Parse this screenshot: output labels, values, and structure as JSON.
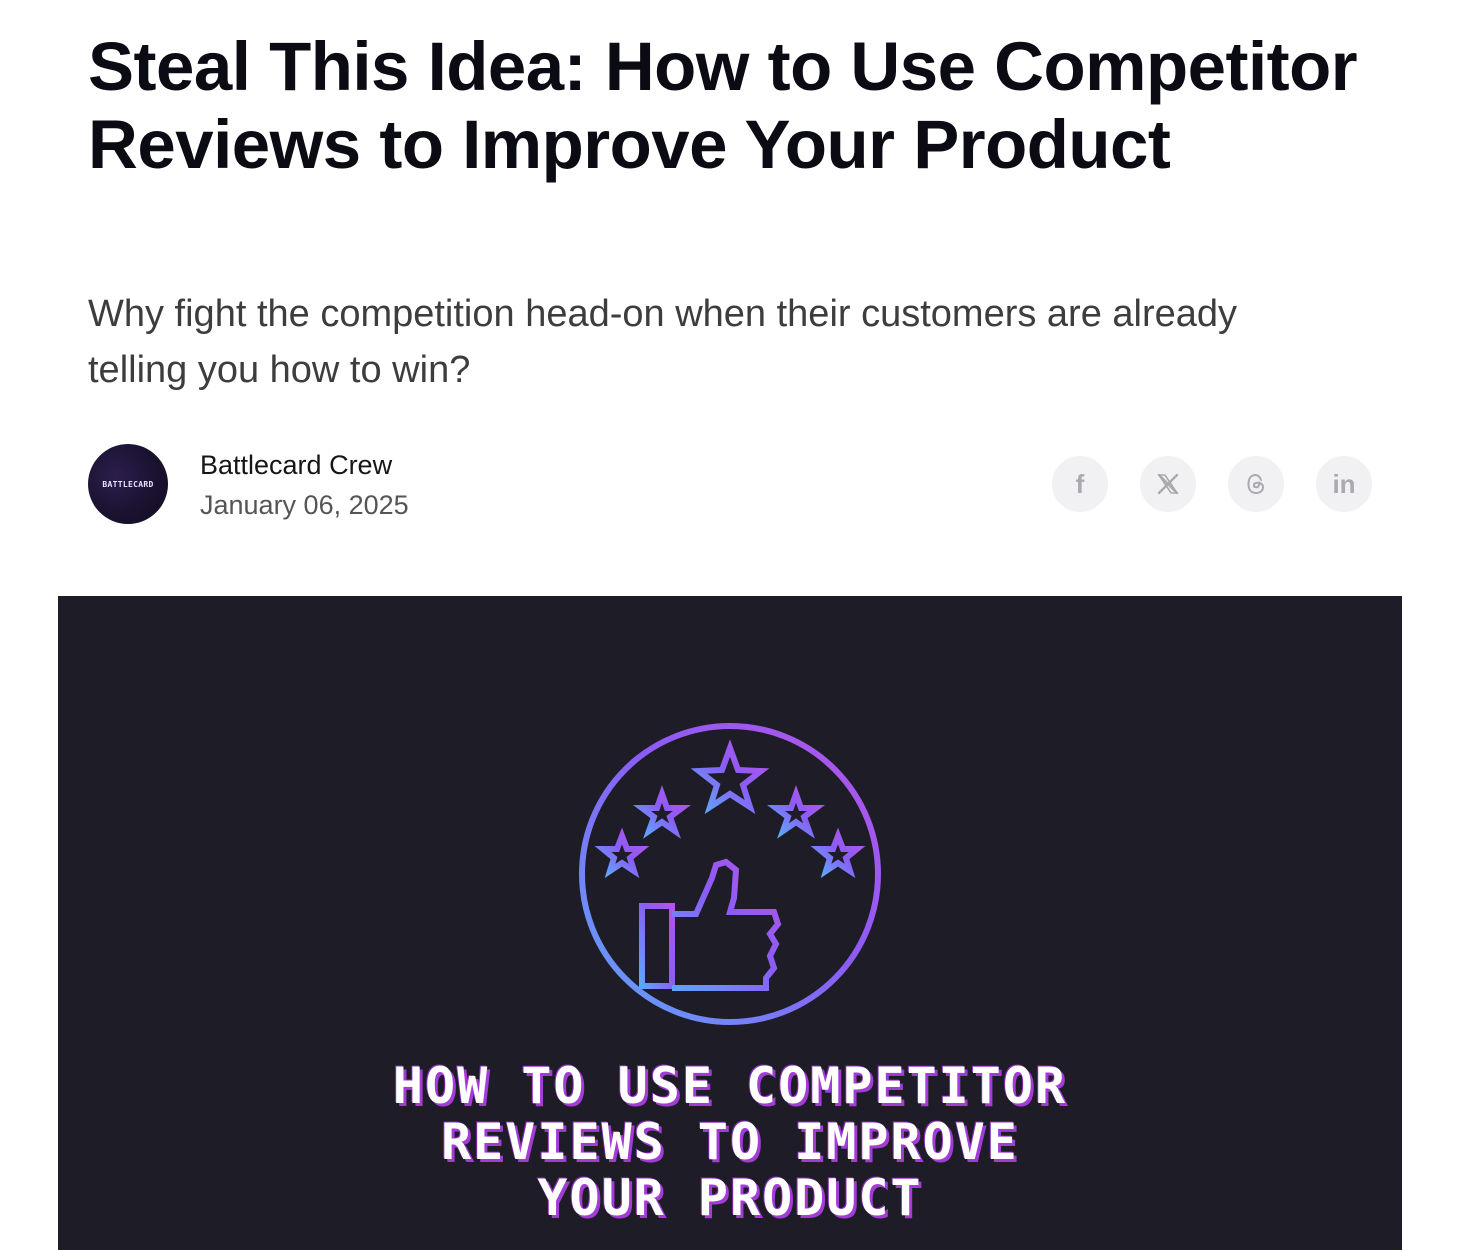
{
  "article": {
    "title": "Steal This Idea: How to Use Competitor Reviews to Improve Your Product",
    "subtitle": "Why fight the competition head-on when their customers are already telling you how to win?"
  },
  "author": {
    "avatar_text": "BATTLECARD",
    "name": "Battlecard Crew",
    "date": "January 06, 2025"
  },
  "share": {
    "icons": [
      "facebook-icon",
      "x-icon",
      "threads-icon",
      "linkedin-icon"
    ],
    "facebook_glyph": "f",
    "linkedin_glyph": "in"
  },
  "hero": {
    "background": "#1e1d27",
    "accent_purple": "#a855f7",
    "accent_blue": "#60a5fa",
    "text": "HOW TO USE COMPETITOR\nREVIEWS TO IMPROVE\nYOUR PRODUCT"
  }
}
